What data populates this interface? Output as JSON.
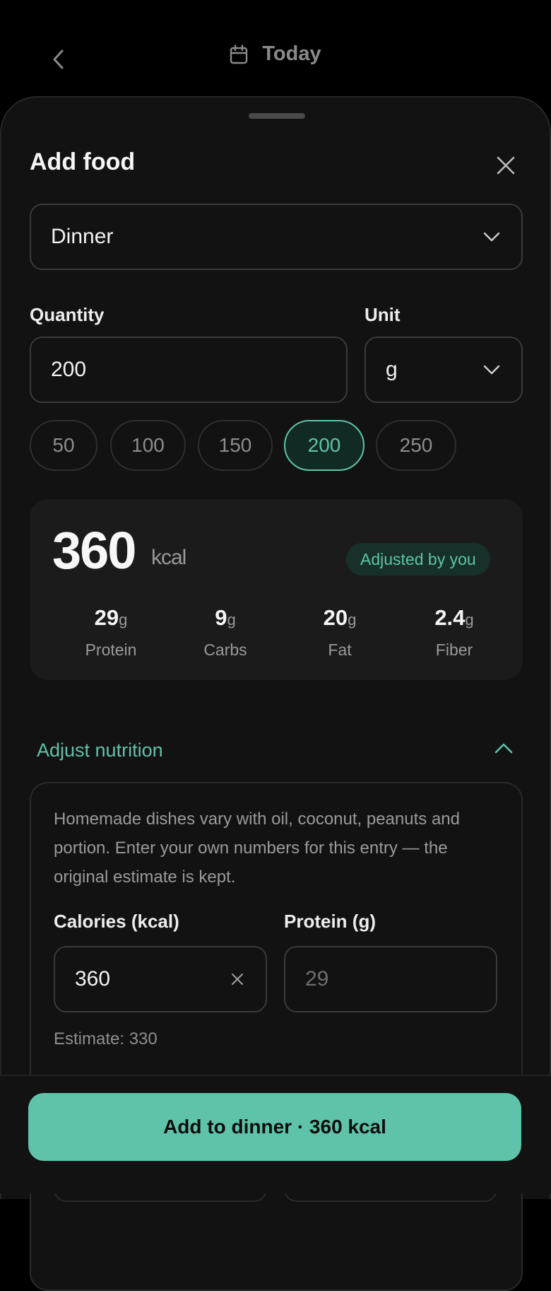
{
  "header": {
    "title": "Today",
    "back_icon": "chevron-left-icon",
    "calendar_icon": "calendar-icon"
  },
  "sheet": {
    "title": "Add food",
    "close_icon": "close-icon"
  },
  "meal": {
    "selected": "Dinner"
  },
  "quantity": {
    "label": "Quantity",
    "value": "200"
  },
  "unit": {
    "label": "Unit",
    "selected": "g"
  },
  "chips": [
    {
      "label": "50",
      "active": false
    },
    {
      "label": "100",
      "active": false
    },
    {
      "label": "150",
      "active": false
    },
    {
      "label": "200",
      "active": true
    },
    {
      "label": "250",
      "active": false
    }
  ],
  "summary": {
    "kcal": "360",
    "kcal_unit": "kcal",
    "badge": "Adjusted by you",
    "macros": [
      {
        "value": "29",
        "unit": "g",
        "label": "Protein"
      },
      {
        "value": "9",
        "unit": "g",
        "label": "Carbs"
      },
      {
        "value": "20",
        "unit": "g",
        "label": "Fat"
      },
      {
        "value": "2.4",
        "unit": "g",
        "label": "Fiber"
      }
    ]
  },
  "adjust": {
    "label": "Adjust nutrition",
    "description": "Homemade dishes vary with oil, coconut, peanuts and portion. Enter your own numbers for this entry — the original estimate is kept.",
    "calories_label": "Calories (kcal)",
    "calories_value": "360",
    "protein_label": "Protein (g)",
    "protein_placeholder": "29",
    "estimate": "Estimate: 330"
  },
  "cta": {
    "label": "Add to dinner · 360 kcal"
  },
  "colors": {
    "accent": "#5fc3aa",
    "background": "#000000",
    "sheet": "#121212",
    "card": "#1b1b1b"
  }
}
